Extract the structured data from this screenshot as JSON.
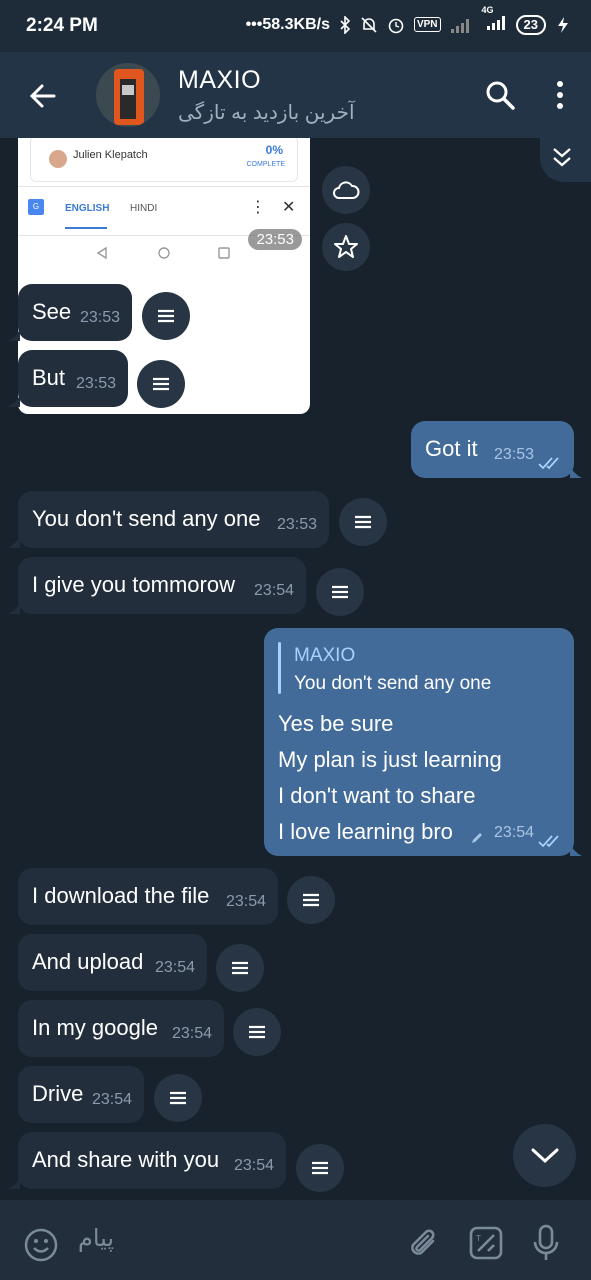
{
  "status_bar": {
    "time": "2:24 PM",
    "network_speed": "58.3KB/s",
    "vpn": "VPN",
    "network_type": "4G",
    "battery": "23"
  },
  "header": {
    "title": "MAXIO",
    "status": "آخرین بازدید به تازگی"
  },
  "image_message": {
    "name": "Julien Klepatch",
    "percent": "0%",
    "progress_label": "COMPLETE",
    "tab_english": "ENGLISH",
    "tab_hindi": "HINDI",
    "time": "23:53"
  },
  "messages": [
    {
      "text": "See",
      "time": "23:53"
    },
    {
      "text": "But",
      "time": "23:53"
    },
    {
      "text": "Got it",
      "time": "23:53"
    },
    {
      "text": "You don't send any one",
      "time": "23:53"
    },
    {
      "text": "I give you tommorow",
      "time": "23:54"
    },
    {
      "reply_name": "MAXIO",
      "reply_text": "You don't send any one",
      "lines": [
        "Yes be sure",
        "My plan is just learning",
        "I don't want to share",
        "I love learning bro"
      ],
      "time": "23:54"
    },
    {
      "text": "I download the file",
      "time": "23:54"
    },
    {
      "text": "And upload",
      "time": "23:54"
    },
    {
      "text": "In my google",
      "time": "23:54"
    },
    {
      "text": "Drive",
      "time": "23:54"
    },
    {
      "text": "And share with you",
      "time": "23:54"
    }
  ],
  "input": {
    "placeholder": "پیام"
  },
  "colors": {
    "background": "#18222d",
    "incoming_bubble": "#232e3c",
    "outgoing_bubble": "#436b99",
    "header": "#243447",
    "accent": "#a8d1ff"
  }
}
